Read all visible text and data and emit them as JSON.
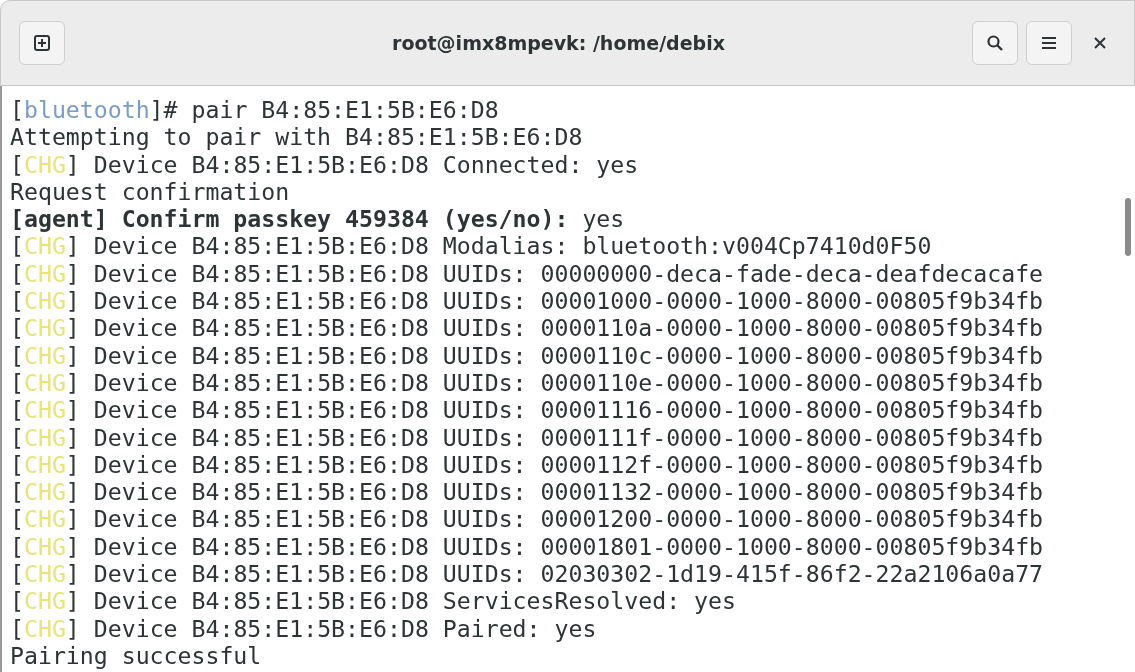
{
  "window": {
    "title": "root@imx8mpevk: /home/debix"
  },
  "terminal": {
    "lines": [
      {
        "kind": "prompt",
        "open": "[",
        "prompt": "bluetooth",
        "close": "]#",
        "command": "pair B4:85:E1:5B:E6:D8"
      },
      {
        "kind": "plain",
        "text": "Attempting to pair with B4:85:E1:5B:E6:D8"
      },
      {
        "kind": "chg",
        "open": "[",
        "tag": "CHG",
        "close": "]",
        "text": "Device B4:85:E1:5B:E6:D8 Connected: yes"
      },
      {
        "kind": "plain",
        "text": "Request confirmation"
      },
      {
        "kind": "agent",
        "question": "[agent] Confirm passkey 459384 (yes/no):",
        "answer": "yes"
      },
      {
        "kind": "chg",
        "open": "[",
        "tag": "CHG",
        "close": "]",
        "text": "Device B4:85:E1:5B:E6:D8 Modalias: bluetooth:v004Cp7410d0F50"
      },
      {
        "kind": "chg",
        "open": "[",
        "tag": "CHG",
        "close": "]",
        "text": "Device B4:85:E1:5B:E6:D8 UUIDs: 00000000-deca-fade-deca-deafdecacafe"
      },
      {
        "kind": "chg",
        "open": "[",
        "tag": "CHG",
        "close": "]",
        "text": "Device B4:85:E1:5B:E6:D8 UUIDs: 00001000-0000-1000-8000-00805f9b34fb"
      },
      {
        "kind": "chg",
        "open": "[",
        "tag": "CHG",
        "close": "]",
        "text": "Device B4:85:E1:5B:E6:D8 UUIDs: 0000110a-0000-1000-8000-00805f9b34fb"
      },
      {
        "kind": "chg",
        "open": "[",
        "tag": "CHG",
        "close": "]",
        "text": "Device B4:85:E1:5B:E6:D8 UUIDs: 0000110c-0000-1000-8000-00805f9b34fb"
      },
      {
        "kind": "chg",
        "open": "[",
        "tag": "CHG",
        "close": "]",
        "text": "Device B4:85:E1:5B:E6:D8 UUIDs: 0000110e-0000-1000-8000-00805f9b34fb"
      },
      {
        "kind": "chg",
        "open": "[",
        "tag": "CHG",
        "close": "]",
        "text": "Device B4:85:E1:5B:E6:D8 UUIDs: 00001116-0000-1000-8000-00805f9b34fb"
      },
      {
        "kind": "chg",
        "open": "[",
        "tag": "CHG",
        "close": "]",
        "text": "Device B4:85:E1:5B:E6:D8 UUIDs: 0000111f-0000-1000-8000-00805f9b34fb"
      },
      {
        "kind": "chg",
        "open": "[",
        "tag": "CHG",
        "close": "]",
        "text": "Device B4:85:E1:5B:E6:D8 UUIDs: 0000112f-0000-1000-8000-00805f9b34fb"
      },
      {
        "kind": "chg",
        "open": "[",
        "tag": "CHG",
        "close": "]",
        "text": "Device B4:85:E1:5B:E6:D8 UUIDs: 00001132-0000-1000-8000-00805f9b34fb"
      },
      {
        "kind": "chg",
        "open": "[",
        "tag": "CHG",
        "close": "]",
        "text": "Device B4:85:E1:5B:E6:D8 UUIDs: 00001200-0000-1000-8000-00805f9b34fb"
      },
      {
        "kind": "chg",
        "open": "[",
        "tag": "CHG",
        "close": "]",
        "text": "Device B4:85:E1:5B:E6:D8 UUIDs: 00001801-0000-1000-8000-00805f9b34fb"
      },
      {
        "kind": "chg",
        "open": "[",
        "tag": "CHG",
        "close": "]",
        "text": "Device B4:85:E1:5B:E6:D8 UUIDs: 02030302-1d19-415f-86f2-22a2106a0a77"
      },
      {
        "kind": "chg",
        "open": "[",
        "tag": "CHG",
        "close": "]",
        "text": "Device B4:85:E1:5B:E6:D8 ServicesResolved: yes"
      },
      {
        "kind": "chg",
        "open": "[",
        "tag": "CHG",
        "close": "]",
        "text": "Device B4:85:E1:5B:E6:D8 Paired: yes"
      },
      {
        "kind": "plain",
        "text": "Pairing successful"
      }
    ]
  }
}
